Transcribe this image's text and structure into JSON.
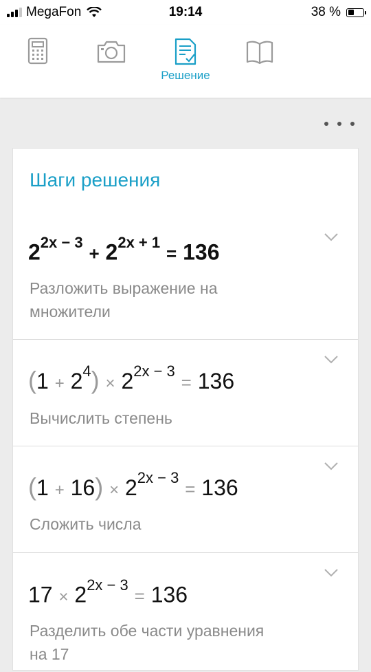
{
  "status_bar": {
    "carrier": "MegaFon",
    "time": "19:14",
    "battery_percent": "38 %"
  },
  "tabs": [
    {
      "name": "calculator",
      "label": ""
    },
    {
      "name": "camera",
      "label": ""
    },
    {
      "name": "solution",
      "label": "Решение",
      "active": true
    },
    {
      "name": "book",
      "label": ""
    }
  ],
  "card": {
    "title": "Шаги решения",
    "steps": [
      {
        "formula": {
          "base1": "2",
          "exp1": "2x − 3",
          "op": "+",
          "base2": "2",
          "exp2": "2x + 1",
          "eq": "=",
          "rhs": "136"
        },
        "description": "Разложить выражение на множители"
      },
      {
        "formula": {
          "lp": "(",
          "a": "1",
          "plus": "+",
          "b_base": "2",
          "b_exp": "4",
          "rp": ")",
          "times": "×",
          "base": "2",
          "exp": "2x − 3",
          "eq": "=",
          "rhs": "136"
        },
        "description": "Вычислить степень"
      },
      {
        "formula": {
          "lp": "(",
          "a": "1",
          "plus": "+",
          "b": "16",
          "rp": ")",
          "times": "×",
          "base": "2",
          "exp": "2x − 3",
          "eq": "=",
          "rhs": "136"
        },
        "description": "Сложить числа"
      },
      {
        "formula": {
          "coef": "17",
          "times": "×",
          "base": "2",
          "exp": "2x − 3",
          "eq": "=",
          "rhs": "136"
        },
        "description": "Разделить обе части уравнения на 17"
      }
    ]
  },
  "colors": {
    "accent": "#1a9fc7",
    "muted": "#8a8a8a",
    "background": "#ececec"
  }
}
